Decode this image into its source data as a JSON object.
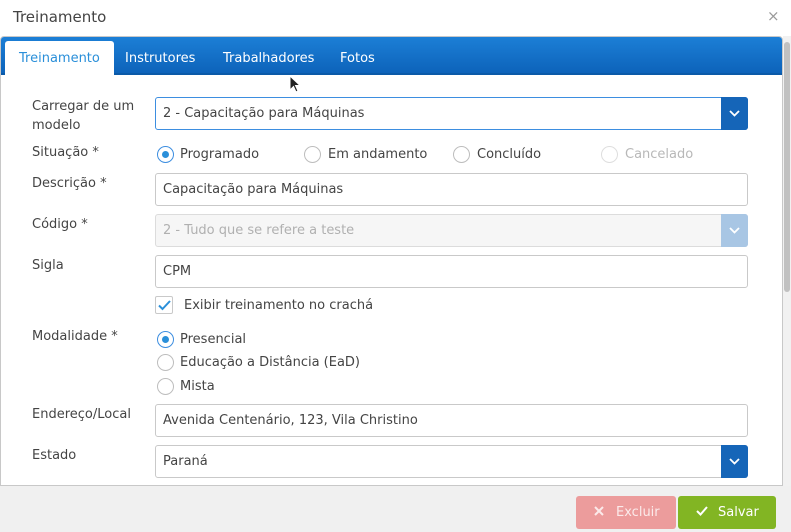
{
  "dialog": {
    "title": "Treinamento",
    "close_symbol": "×"
  },
  "tabs": [
    "Treinamento",
    "Instrutores",
    "Trabalhadores",
    "Fotos"
  ],
  "form": {
    "modelo": {
      "label": "Carregar de um modelo",
      "value": "2 - Capacitação para Máquinas"
    },
    "situacao": {
      "label": "Situação *",
      "options": [
        "Programado",
        "Em andamento",
        "Concluído",
        "Cancelado"
      ],
      "selected": "Programado",
      "disabled": [
        "Cancelado"
      ]
    },
    "descricao": {
      "label": "Descrição *",
      "value": "Capacitação para Máquinas"
    },
    "codigo": {
      "label": "Código *",
      "value": "2 - Tudo que se refere a teste"
    },
    "sigla": {
      "label": "Sigla",
      "value": "CPM"
    },
    "cracha": {
      "label": "Exibir treinamento no crachá",
      "checked": true
    },
    "modalidade": {
      "label": "Modalidade *",
      "options": [
        "Presencial",
        "Educação a Distância (EaD)",
        "Mista"
      ],
      "selected": "Presencial"
    },
    "endereco": {
      "label": "Endereço/Local",
      "value": "Avenida Centenário, 123, Vila Christino"
    },
    "estado": {
      "label": "Estado",
      "value": "Paraná"
    }
  },
  "footer": {
    "delete_label": "Excluir",
    "save_label": "Salvar"
  },
  "colors": {
    "primary": "#1565b8",
    "tab_active_text": "#2a8fd9",
    "delete": "#ec9c9c",
    "save": "#82b523"
  }
}
